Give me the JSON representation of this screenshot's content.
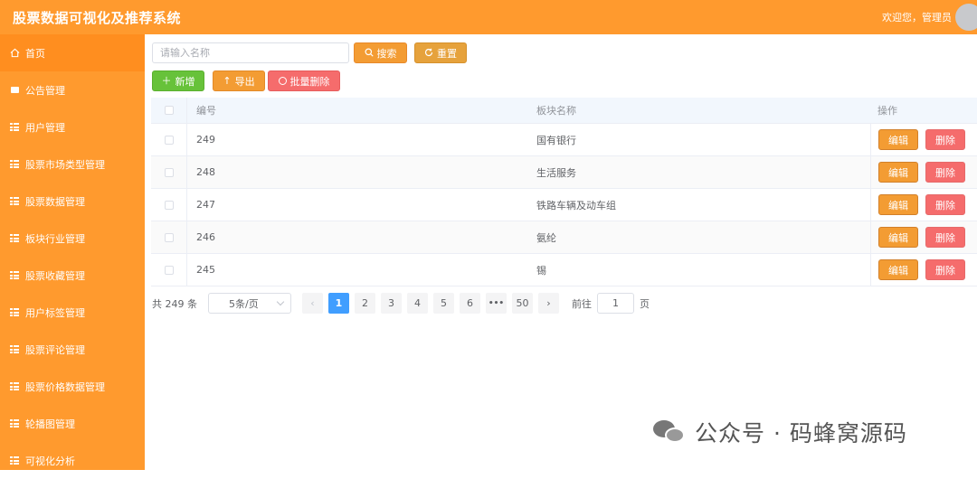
{
  "header": {
    "title": "股票数据可视化及推荐系统",
    "welcome": "欢迎您，管理员"
  },
  "sidebar": {
    "items": [
      {
        "label": "首页",
        "icon": "home-icon"
      },
      {
        "label": "公告管理",
        "icon": "chat-icon"
      },
      {
        "label": "用户管理",
        "icon": "grid-icon"
      },
      {
        "label": "股票市场类型管理",
        "icon": "grid-icon"
      },
      {
        "label": "股票数据管理",
        "icon": "grid-icon"
      },
      {
        "label": "板块行业管理",
        "icon": "grid-icon"
      },
      {
        "label": "股票收藏管理",
        "icon": "grid-icon"
      },
      {
        "label": "用户标签管理",
        "icon": "grid-icon"
      },
      {
        "label": "股票评论管理",
        "icon": "grid-icon"
      },
      {
        "label": "股票价格数据管理",
        "icon": "grid-icon"
      },
      {
        "label": "轮播图管理",
        "icon": "grid-icon"
      },
      {
        "label": "可视化分析",
        "icon": "grid-icon"
      }
    ]
  },
  "search": {
    "placeholder": "请输入名称",
    "search_label": "搜索",
    "reset_label": "重置"
  },
  "actions": {
    "add_label": "新增",
    "export_label": "导出",
    "batch_delete_label": "批量删除"
  },
  "table": {
    "headers": {
      "id": "编号",
      "name": "板块名称",
      "ops": "操作"
    },
    "rows": [
      {
        "id": "249",
        "name": "国有银行"
      },
      {
        "id": "248",
        "name": "生活服务"
      },
      {
        "id": "247",
        "name": "铁路车辆及动车组"
      },
      {
        "id": "246",
        "name": "氨纶"
      },
      {
        "id": "245",
        "name": "锡"
      }
    ],
    "edit_label": "编辑",
    "delete_label": "删除"
  },
  "pagination": {
    "total": "共 249 条",
    "page_size": "5条/页",
    "prev": "‹",
    "next": "›",
    "pages": [
      "1",
      "2",
      "3",
      "4",
      "5",
      "6",
      "•••",
      "50"
    ],
    "current": "1",
    "goto_prefix": "前往",
    "goto_value": "1",
    "goto_suffix": "页"
  },
  "watermark": "公众号 · 码蜂窝源码",
  "colors": {
    "brand": "#ff9a2e",
    "primary": "#409eff",
    "success": "#67c23a",
    "danger": "#f56c6c",
    "warning": "#e6a23c"
  }
}
